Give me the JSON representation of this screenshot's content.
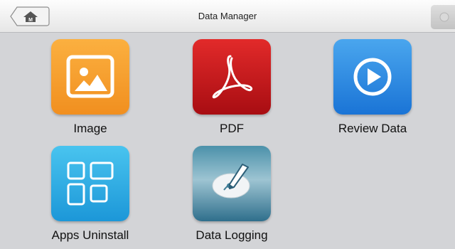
{
  "header": {
    "title": "Data Manager",
    "home_icon": "home-icon",
    "corner_icon": "settings-icon"
  },
  "apps": [
    {
      "label": "Image",
      "icon": "image-icon",
      "color": "#f5a02d"
    },
    {
      "label": "PDF",
      "icon": "pdf-icon",
      "color": "#c81a1f"
    },
    {
      "label": "Review Data",
      "icon": "play-icon",
      "color": "#2f8ce4"
    },
    {
      "label": "Apps Uninstall",
      "icon": "apps-grid-icon",
      "color": "#2eaee5"
    },
    {
      "label": "Data Logging",
      "icon": "data-logging-icon",
      "color": "#3f86a2"
    }
  ]
}
